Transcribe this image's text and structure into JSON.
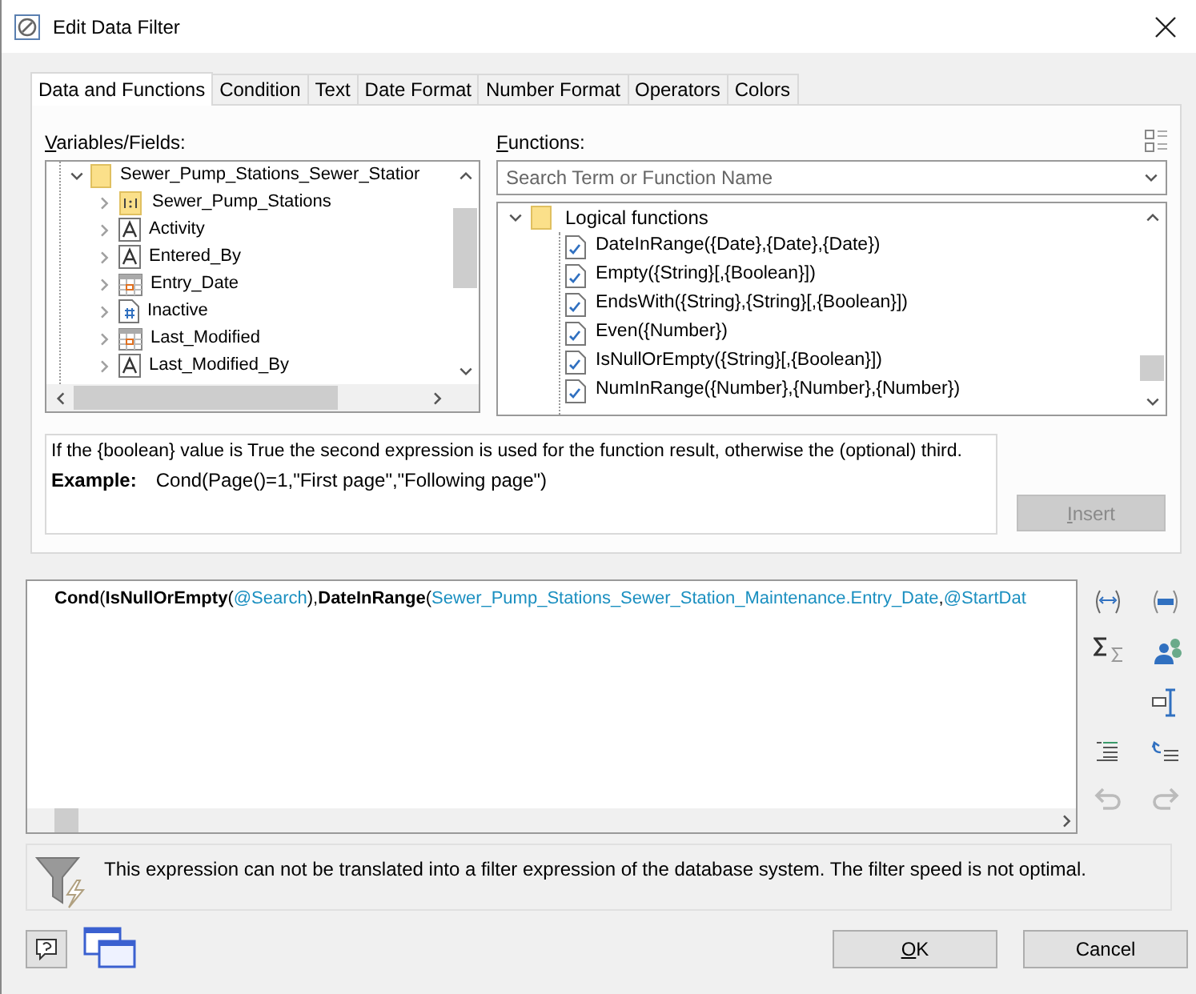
{
  "window": {
    "title": "Edit Data Filter"
  },
  "tabs": [
    {
      "label": "Data and Functions",
      "selected": true
    },
    {
      "label": "Condition",
      "selected": false
    },
    {
      "label": "Text",
      "selected": false
    },
    {
      "label": "Date Format",
      "selected": false
    },
    {
      "label": "Number Format",
      "selected": false
    },
    {
      "label": "Operators",
      "selected": false
    },
    {
      "label": "Colors",
      "selected": false
    }
  ],
  "variables": {
    "label": "Variables/Fields:",
    "items": [
      {
        "label": "Sewer_Pump_Stations_Sewer_Statior",
        "kind": "folder",
        "expanded": true,
        "children": [
          {
            "label": "Sewer_Pump_Stations",
            "kind": "relation"
          },
          {
            "label": "Activity",
            "kind": "text"
          },
          {
            "label": "Entered_By",
            "kind": "text"
          },
          {
            "label": "Entry_Date",
            "kind": "date"
          },
          {
            "label": "Inactive",
            "kind": "bool"
          },
          {
            "label": "Last_Modified",
            "kind": "date"
          },
          {
            "label": "Last_Modified_By",
            "kind": "text"
          }
        ]
      }
    ]
  },
  "functions": {
    "label": "Functions:",
    "search": {
      "placeholder": "Search Term or Function Name"
    },
    "items": [
      {
        "label": "Logical functions",
        "expanded": true,
        "children": [
          {
            "label": "DateInRange({Date},{Date},{Date})"
          },
          {
            "label": "Empty({String}[,{Boolean}])"
          },
          {
            "label": "EndsWith({String},{String}[,{Boolean}])"
          },
          {
            "label": "Even({Number})"
          },
          {
            "label": "IsNullOrEmpty({String}[,{Boolean}])"
          },
          {
            "label": "NumInRange({Number},{Number},{Number})"
          }
        ]
      }
    ]
  },
  "description": {
    "text": "If the {boolean} value is True the second expression is used for the function result, otherwise the (optional) third.",
    "example_label": "Example:",
    "example": "Cond(Page()=1,\"First page\",\"Following page\")"
  },
  "insert_button": {
    "label": "Insert",
    "disabled": true
  },
  "expression": [
    {
      "text": "Cond",
      "kind": "function"
    },
    {
      "text": "(",
      "kind": "punct"
    },
    {
      "text": "IsNullOrEmpty",
      "kind": "function"
    },
    {
      "text": "(",
      "kind": "punct"
    },
    {
      "text": "@Search",
      "kind": "field"
    },
    {
      "text": "),",
      "kind": "punct"
    },
    {
      "text": "DateInRange",
      "kind": "function"
    },
    {
      "text": "(",
      "kind": "punct"
    },
    {
      "text": "Sewer_Pump_Stations_Sewer_Station_Maintenance.Entry_Date",
      "kind": "field"
    },
    {
      "text": ",",
      "kind": "punct"
    },
    {
      "text": "@StartDat",
      "kind": "field"
    }
  ],
  "warning": "This expression can not be translated into a filter expression of the database system. The filter speed is not optimal.",
  "buttons": [
    {
      "label": "OK"
    },
    {
      "label": "Cancel"
    }
  ]
}
